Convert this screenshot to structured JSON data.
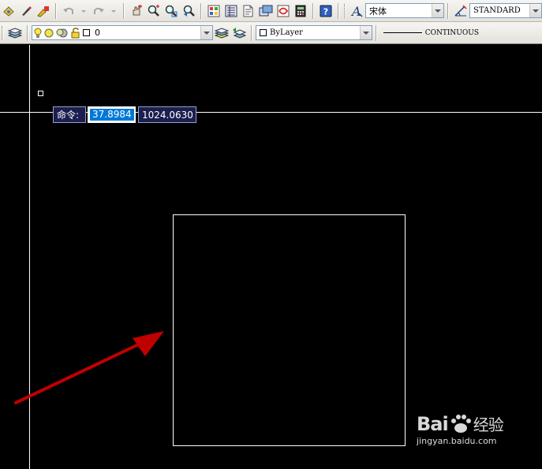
{
  "toolbar_standard": {
    "text_style_font": "宋体",
    "dim_style": "STANDARD"
  },
  "toolbar_layers": {
    "current_layer": "0",
    "color": "ByLayer",
    "linetype": "CONTINUOUS"
  },
  "dynamic_input": {
    "prompt": "命令:",
    "x_value": "37.8984",
    "y_value": "1024.0630"
  },
  "watermark": {
    "logo_text": "Bai",
    "logo_text_2": "经验",
    "url": "jingyan.baidu.com"
  },
  "colors": {
    "canvas_background": "#000000",
    "annotation_arrow": "#c00000",
    "dynamic_input_bg": "#1b1e4f",
    "selection_highlight": "#0078d7"
  }
}
